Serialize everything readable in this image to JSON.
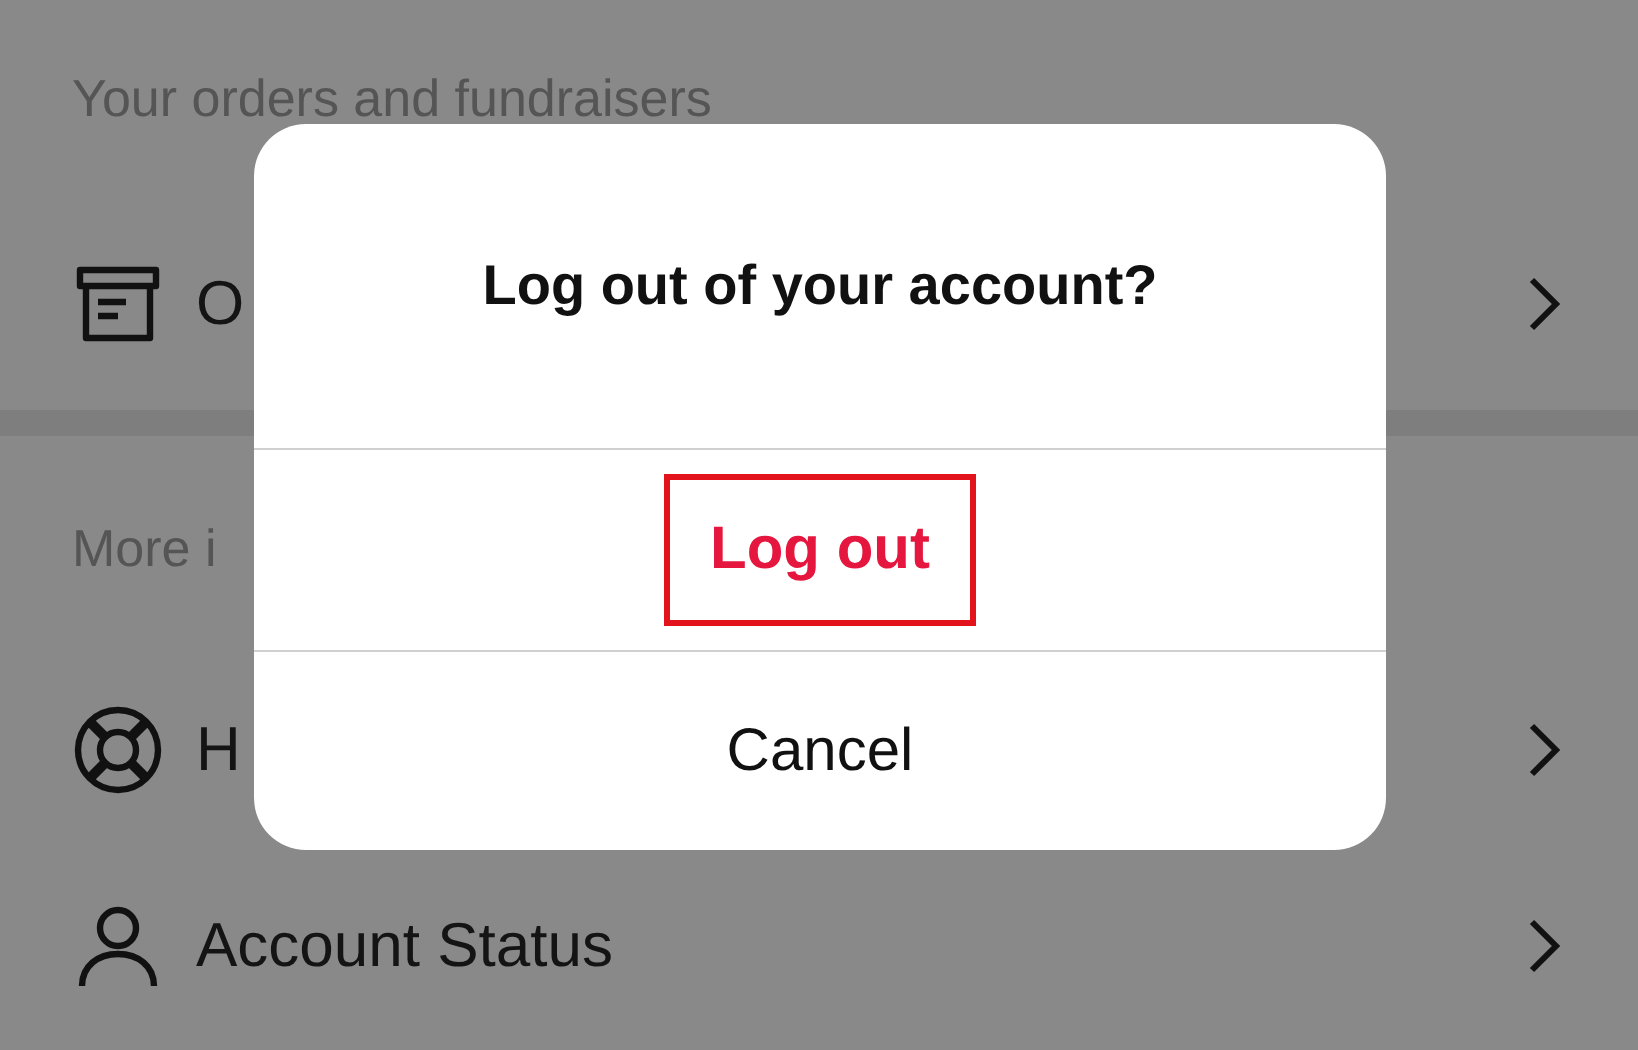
{
  "sections": [
    {
      "header": "Your orders and fundraisers",
      "rows": [
        {
          "kind": "box",
          "label": "O"
        }
      ]
    },
    {
      "header": "More i",
      "rows": [
        {
          "kind": "lifebuoy",
          "label": "H"
        },
        {
          "kind": "person",
          "label": "Account Status"
        }
      ]
    }
  ],
  "dialog": {
    "title": "Log out of your account?",
    "actions": [
      {
        "label": "Log out",
        "kind": "destructive",
        "highlighted": true
      },
      {
        "label": "Cancel",
        "kind": "default",
        "highlighted": false
      }
    ]
  }
}
